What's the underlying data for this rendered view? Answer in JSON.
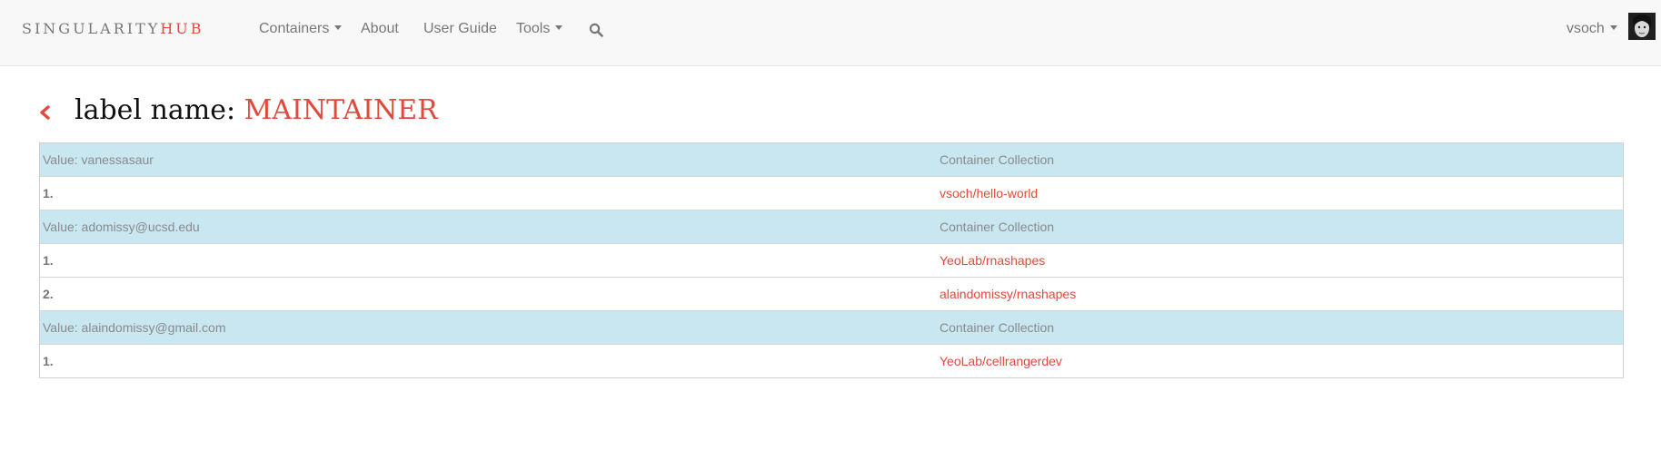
{
  "navbar": {
    "brand_main": "SINGULARITY",
    "brand_accent": "HUB",
    "links": [
      {
        "label": "Containers",
        "dropdown": true
      },
      {
        "label": "About",
        "dropdown": false
      },
      {
        "label": "User Guide",
        "dropdown": false
      },
      {
        "label": "Tools",
        "dropdown": true
      }
    ],
    "search_icon": "search-icon",
    "user": {
      "name": "vsoch",
      "dropdown": true
    }
  },
  "page": {
    "title_prefix": "label name: ",
    "title_value": "MAINTAINER",
    "back_icon": "chevron-left-icon"
  },
  "table": {
    "groups": [
      {
        "value_label": "Value: vanessasaur",
        "column_label": "Container Collection",
        "items": [
          {
            "index": "1.",
            "collection": "vsoch/hello-world"
          }
        ]
      },
      {
        "value_label": "Value: adomissy@ucsd.edu",
        "column_label": "Container Collection",
        "items": [
          {
            "index": "1.",
            "collection": "YeoLab/rnashapes"
          },
          {
            "index": "2.",
            "collection": "alaindomissy/rnashapes"
          }
        ]
      },
      {
        "value_label": "Value: alaindomissy@gmail.com",
        "column_label": "Container Collection",
        "items": [
          {
            "index": "1.",
            "collection": "YeoLab/cellrangerdev"
          }
        ]
      }
    ]
  },
  "colors": {
    "accent": "#e04a3c",
    "header_row_bg": "#c9e7f1",
    "navbar_bg": "#f8f8f8",
    "muted_text": "#777777"
  }
}
